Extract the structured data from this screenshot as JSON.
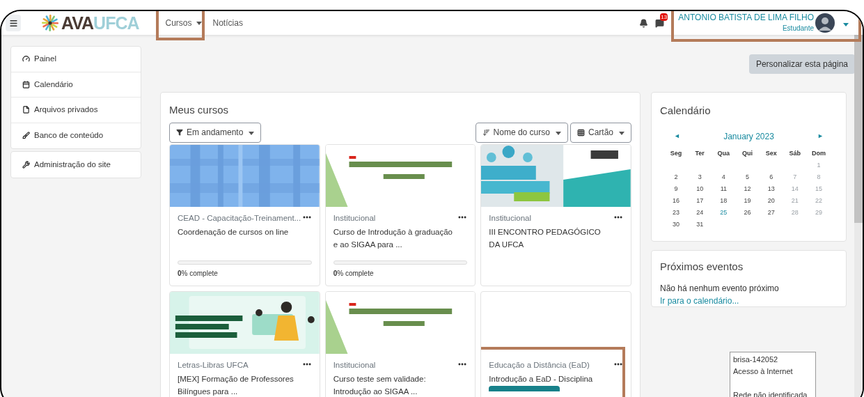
{
  "logo": {
    "part1": "AVA",
    "part2": "UFCA"
  },
  "nav": [
    {
      "label": "Cursos",
      "dropdown": true,
      "highlighted": true
    },
    {
      "label": "Notícias",
      "dropdown": false,
      "highlighted": false
    }
  ],
  "notifications": {
    "badge": "13"
  },
  "user": {
    "name": "ANTONIO BATISTA DE LIMA FILHO",
    "role": "Estudante",
    "highlighted": true
  },
  "sidebar": {
    "groups": [
      [
        {
          "label": "Painel"
        },
        {
          "label": "Calendário"
        },
        {
          "label": "Arquivos privados"
        },
        {
          "label": "Banco de conteúdo"
        }
      ],
      [
        {
          "label": "Administração do site"
        }
      ]
    ]
  },
  "customize_button": "Personalizar esta página",
  "courses": {
    "title": "Meus cursos",
    "filter": "Em andamento",
    "sort": "Nome do curso",
    "view": "Cartão",
    "cards": [
      {
        "category": "CEAD - Capacitação-Treinament...",
        "name": "Coordenação de cursos on line",
        "progress": "**0**% complete",
        "level": 0,
        "highlighted": false
      },
      {
        "category": "Institucional",
        "name": "Curso de Introdução à graduação e ao SIGAA para ...",
        "progress": "**0**% complete",
        "level": 0,
        "highlighted": false
      },
      {
        "category": "Institucional",
        "name": "III ENCONTRO PEDAGÓGICO DA UFCA",
        "highlighted": false
      },
      {
        "category": "Letras-Libras UFCA",
        "name": "[MEX] Formação de Professores Bilíngues para ...",
        "highlighted": false
      },
      {
        "category": "Institucional",
        "name": "Curso teste sem validade: Introdução ao SIGAA ...",
        "highlighted": false
      },
      {
        "category": "Educação a Distância (EaD)",
        "name": "Introdução a EaD - Disciplina",
        "tag": true,
        "highlighted": true
      }
    ]
  },
  "calendar": {
    "title": "Calendário",
    "month": "January 2023",
    "prev": "◄",
    "next": "►",
    "weekdays": [
      "Seg",
      "Ter",
      "Qua",
      "Qui",
      "Sex",
      "Sáb",
      "Dom"
    ],
    "weeks": [
      [
        {
          "kind": "blank"
        },
        {
          "kind": "blank"
        },
        {
          "kind": "blank"
        },
        {
          "kind": "blank"
        },
        {
          "kind": "blank"
        },
        {
          "kind": "blank"
        },
        {
          "day": "1",
          "kind": "weekend"
        }
      ],
      [
        {
          "day": "2",
          "kind": "weekday"
        },
        {
          "day": "3",
          "kind": "weekday"
        },
        {
          "day": "4",
          "kind": "weekday"
        },
        {
          "day": "5",
          "kind": "weekday"
        },
        {
          "day": "6",
          "kind": "weekday"
        },
        {
          "day": "7",
          "kind": "weekend"
        },
        {
          "day": "8",
          "kind": "weekend"
        }
      ],
      [
        {
          "day": "9",
          "kind": "weekday"
        },
        {
          "day": "10",
          "kind": "weekday"
        },
        {
          "day": "11",
          "kind": "weekday"
        },
        {
          "day": "12",
          "kind": "weekday"
        },
        {
          "day": "13",
          "kind": "weekday"
        },
        {
          "day": "14",
          "kind": "weekend"
        },
        {
          "day": "15",
          "kind": "weekend"
        }
      ],
      [
        {
          "day": "16",
          "kind": "weekday"
        },
        {
          "day": "17",
          "kind": "weekday"
        },
        {
          "day": "18",
          "kind": "weekday"
        },
        {
          "day": "19",
          "kind": "weekday"
        },
        {
          "day": "20",
          "kind": "weekday"
        },
        {
          "day": "21",
          "kind": "weekend"
        },
        {
          "day": "22",
          "kind": "weekend"
        }
      ],
      [
        {
          "day": "23",
          "kind": "weekday"
        },
        {
          "day": "24",
          "kind": "weekday"
        },
        {
          "day": "25",
          "kind": "today"
        },
        {
          "day": "26",
          "kind": "weekday"
        },
        {
          "day": "27",
          "kind": "weekday"
        },
        {
          "day": "28",
          "kind": "weekend"
        },
        {
          "day": "29",
          "kind": "weekend"
        }
      ],
      [
        {
          "day": "30",
          "kind": "weekday"
        },
        {
          "day": "31",
          "kind": "weekday"
        }
      ]
    ]
  },
  "events": {
    "title": "Próximos eventos",
    "empty": "Não há nenhum evento próximo",
    "link": "Ir para o calendário..."
  },
  "tooltip": [
    "brisa-142052",
    "Acesso à Internet",
    "Rede não identificada"
  ]
}
